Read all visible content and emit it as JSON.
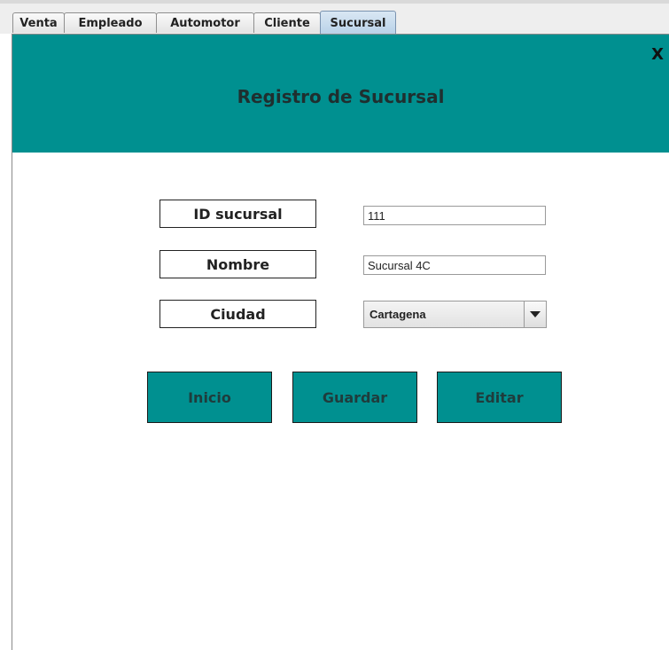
{
  "tabs": [
    {
      "label": "Venta",
      "active": false
    },
    {
      "label": "Empleado",
      "active": false
    },
    {
      "label": "Automotor",
      "active": false
    },
    {
      "label": "Cliente",
      "active": false
    },
    {
      "label": "Sucursal",
      "active": true
    }
  ],
  "header": {
    "title": "Registro de Sucursal",
    "close_label": "X",
    "color": "#009090"
  },
  "form": {
    "id_label": "ID sucursal",
    "id_value": "111",
    "name_label": "Nombre",
    "name_value": "Sucursal 4C",
    "city_label": "Ciudad",
    "city_value": "Cartagena"
  },
  "buttons": {
    "inicio": "Inicio",
    "guardar": "Guardar",
    "editar": "Editar"
  }
}
